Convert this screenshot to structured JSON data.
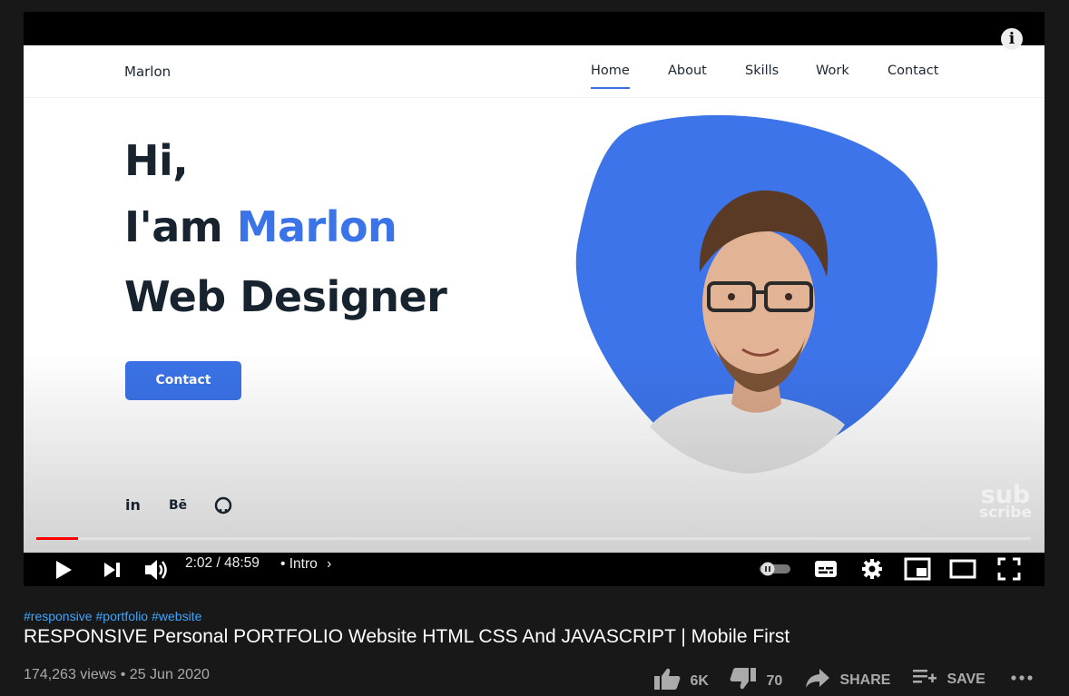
{
  "player": {
    "info_icon": "i",
    "site": {
      "logo": "Marlon",
      "nav": [
        "Home",
        "About",
        "Skills",
        "Work",
        "Contact"
      ],
      "active_nav": "Home",
      "hero_greeting": "Hi,",
      "hero_intro_prefix": "I'am",
      "hero_name": "Marlon",
      "hero_role": "Web Designer",
      "cta_label": "Contact",
      "social": [
        "in",
        "Bē",
        "github-icon"
      ],
      "accent_color": "#3b73e8"
    },
    "watermark": [
      "sub",
      "scribe"
    ],
    "progress": {
      "played_fraction": 0.0416
    },
    "controls": {
      "current_time": "2:02",
      "duration": "48:59",
      "chapter": "Intro"
    }
  },
  "video": {
    "hashtags": [
      "#responsive",
      "#portfolio",
      "#website"
    ],
    "title": "RESPONSIVE Personal PORTFOLIO Website HTML CSS And JAVASCRIPT | Mobile First",
    "views": "174,263 views",
    "date": "25 Jun 2020",
    "likes": "6K",
    "dislikes": "70",
    "share_label": "SHARE",
    "save_label": "SAVE"
  }
}
